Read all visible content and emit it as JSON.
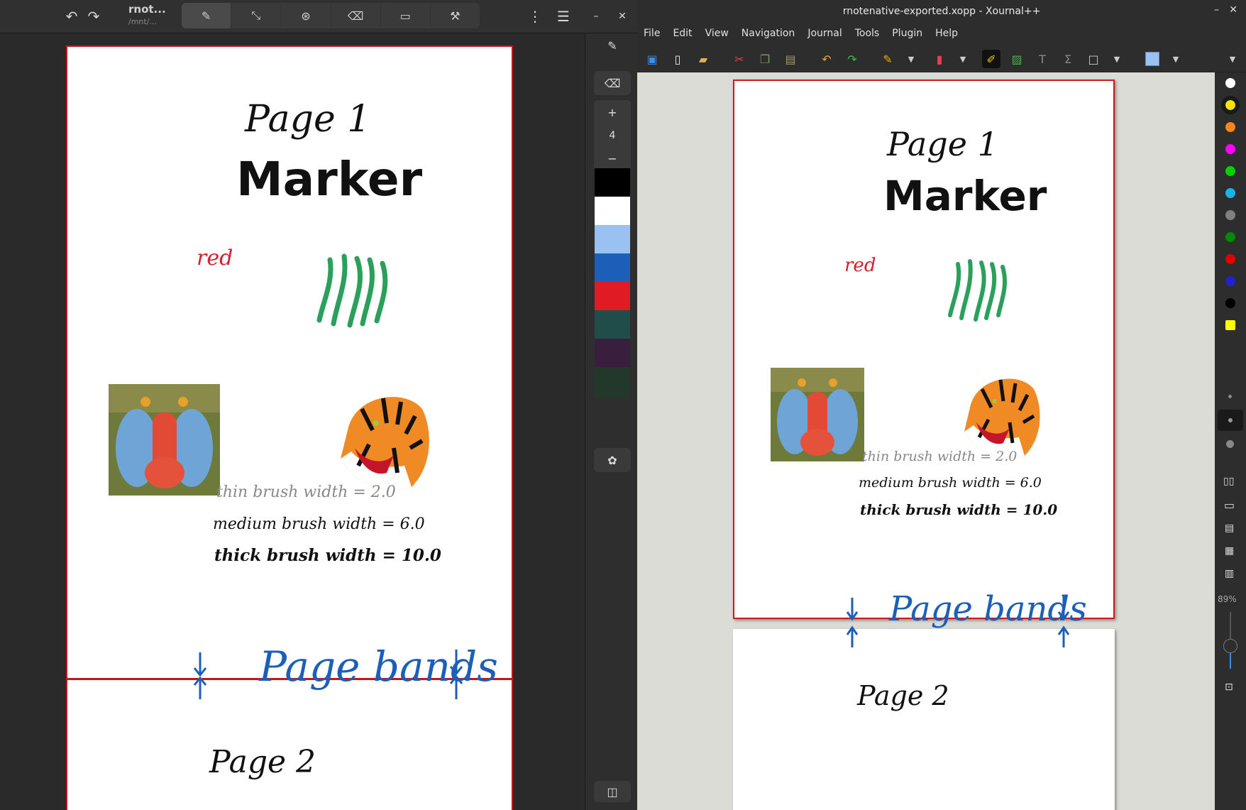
{
  "rnote": {
    "title": "rnot...",
    "subtitle": "/mnt/...",
    "stroke_width": "4",
    "swatches": [
      "#000000",
      "#ffffff",
      "#99c1f1",
      "#1c5fb8",
      "#e01b24",
      "#1f4e4a",
      "#3a1e3e",
      "#22382b"
    ],
    "page1": {
      "title": "Page 1",
      "heading": "Marker",
      "red_label": "red",
      "thin": "thin brush width = 2.0",
      "medium": "medium brush width = 6.0",
      "thick": "thick brush width = 10.0",
      "bands": "Page bands"
    },
    "page2": {
      "title": "Page 2"
    }
  },
  "xournal": {
    "window_title": "rnotenative-exported.xopp - Xournal++",
    "menu": [
      "File",
      "Edit",
      "View",
      "Navigation",
      "Journal",
      "Tools",
      "Plugin",
      "Help"
    ],
    "zoom": "89%",
    "page1": {
      "title": "Page 1",
      "heading": "Marker",
      "red_label": "red",
      "thin": "thin brush width = 2.0",
      "medium": "medium brush width = 6.0",
      "thick": "thick brush width = 10.0",
      "bands": "Page bands"
    },
    "page2": {
      "title": "Page 2"
    },
    "palette": [
      "#ffffff",
      "#f5e400",
      "#f5861f",
      "#ff00ff",
      "#00d000",
      "#18b4e8",
      "#808080",
      "#008a00",
      "#e00000",
      "#2222cc",
      "#000000",
      "#ffff00"
    ]
  }
}
